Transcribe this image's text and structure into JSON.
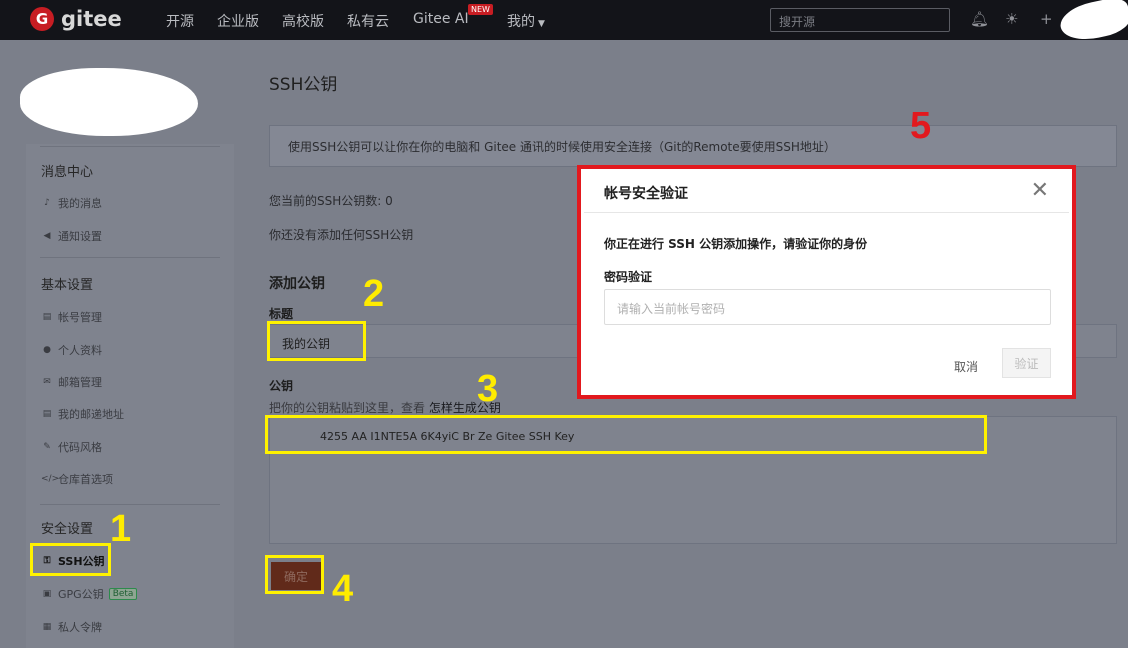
{
  "topbar": {
    "logo_letter": "G",
    "logo_text": "gitee",
    "nav": [
      "开源",
      "企业版",
      "高校版",
      "私有云",
      "Gitee AI",
      "我的"
    ],
    "new_badge": "NEW",
    "search_placeholder": "搜开源"
  },
  "sidebar": {
    "groups": [
      {
        "title": "消息中心",
        "items": [
          "我的消息",
          "通知设置"
        ]
      },
      {
        "title": "基本设置",
        "items": [
          "帐号管理",
          "个人资料",
          "邮箱管理",
          "我的邮递地址",
          "代码风格",
          "仓库首选项"
        ]
      },
      {
        "title": "安全设置",
        "items": [
          "SSH公钥",
          "GPG公钥",
          "私人令牌"
        ]
      }
    ],
    "beta_badge": "Beta"
  },
  "main": {
    "title": "SSH公钥",
    "info": "使用SSH公钥可以让你在你的电脑和 Gitee 通讯的时候使用安全连接（Git的Remote要使用SSH地址）",
    "count_text": "您当前的SSH公钥数: 0",
    "empty_text": "你还没有添加任何SSH公钥",
    "add_section": "添加公钥",
    "title_label": "标题",
    "title_value": "我的公钥",
    "key_label": "公钥",
    "key_hint": "把你的公钥粘贴到这里，查看",
    "key_hint_link": "怎样生成公钥",
    "key_value": "4255   AA         I1NTE5A          6K4yiC             Br   Ze             Gitee SSH Key",
    "confirm_button": "确定"
  },
  "modal": {
    "title": "帐号安全验证",
    "message": "你正在进行 SSH 公钥添加操作，请验证你的身份",
    "password_label": "密码验证",
    "password_placeholder": "请输入当前帐号密码",
    "cancel": "取消",
    "verify": "验证"
  },
  "annotations": [
    "1",
    "2",
    "3",
    "4",
    "5"
  ],
  "colors": {
    "highlight": "#fff200",
    "modal_border": "#e2191e",
    "brand": "#c71d23"
  }
}
